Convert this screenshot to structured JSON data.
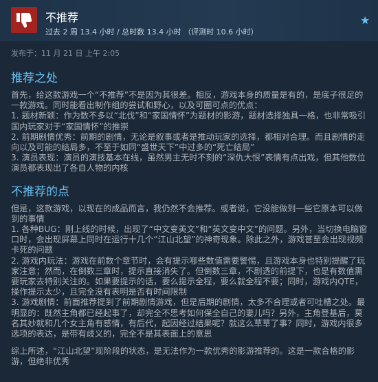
{
  "review": {
    "verdict": "不推荐",
    "hours": "过去 2 周 13.4 小时 / 总时数 13.4 小时 （评测时 10.6 小时）",
    "posted": "发布于：11 月 21 日 上午 2:05",
    "pros_heading": "推荐之处",
    "pros_intro": "首先，给这款游戏一个“不推荐”不是因为其很差。相反，游戏本身的质量是有的，是底子很足的一款游戏。同时能看出制作组的尝试和野心，以及可圈可点的优点：",
    "pros": [
      "1. 题材新颖：作为数不多以“北伐”和“家国情怀”为题材的影游，题材选择独具一格，也非常吸引国内玩家对于“家国情怀”的推崇",
      "2. 前期剧情优秀：前期的剧情，无论是叙事或者是推动玩家的选择，都相对合理。而且剧情的走向以及可能的结局多，不至于如同“盛世天下”中过多的“死亡结局”",
      "3. 演员表现：演员的演技基本在线，虽然男主无时不刻的“深仇大恨”表情有点出戏，但其他数位演员都表现出了各自人物的内核"
    ],
    "cons_heading": "不推荐的点",
    "cons_intro": "但是，这款游戏，以现在的成品而言，我仍然不会推荐。或者说，它没能做到一些它原本可以做到的事情",
    "cons": [
      "1. 各种BUG：刚上线的时候，出现了“中文变英文”和“英文变中文”的问题。另外，当切换电脑窗口时，会出现屏幕上同时在运行十几个“江山北望”的神奇现象。除此之外，游戏甚至会出现视频卡死的问题",
      "2. 游戏内玩法：游戏在前数个章节时，会有提示哪些数值需要警惕，且游戏本身也特别提醒了玩家注意；然而，在倒数三章时，提示直接消失了。但倒数三章，不剧透的前提下，也是有数值需要玩家去特别关注的。如果要提示的话，要么提示全程，要么就全程不要；同时，游戏内QTE，操作提示太少，且完全没有表明是否有时间限制",
      "3. 游戏剧情：前面推荐提到了前期剧情游戏，但是后期的剧情，太多不合理或者可吐槽之处。最明显的：既然主角都已经起事了，却完全不思考如何保全自己的妻儿吗？另外，主角登基后，莫名其妙就和几个女主角有感情，有后代，起因经过结果呢？就这么草草了事？同时，游戏内很多选项的表达，是带有歧义的，完全不是其表面上的意思"
    ],
    "conclusion": "综上所述，“江山北望”现阶段的状态，是无法作为一款优秀的影游推荐的。这是一款合格的影游，但绝非优秀"
  },
  "colors": {
    "background": "#1b2838",
    "thumb_down": "#a3231f",
    "heading": "#66c0f4",
    "text": "#acb2b8"
  },
  "icons": {
    "verdict": "thumbs-down-icon",
    "award": "star-icon"
  }
}
